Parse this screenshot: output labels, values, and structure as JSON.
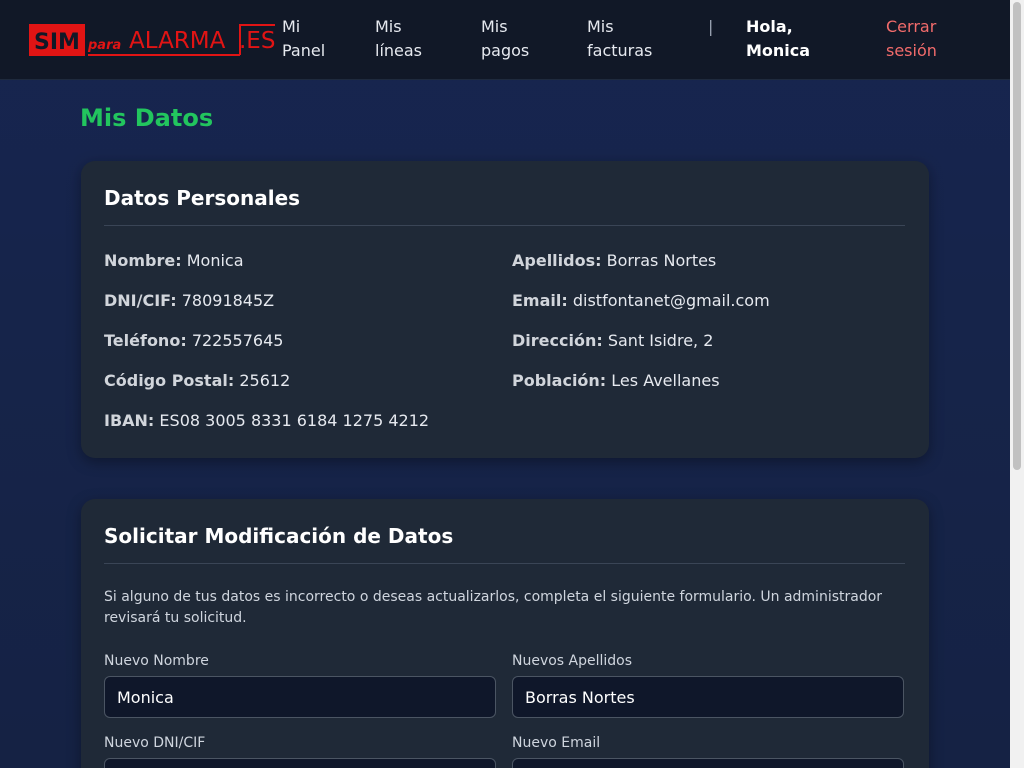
{
  "header": {
    "logo": {
      "sim": "SIM",
      "para": "para",
      "alarma": "ALARMA",
      "es": ".ES"
    },
    "nav": [
      {
        "line1": "Mi",
        "line2": "Panel"
      },
      {
        "line1": "Mis",
        "line2": "líneas"
      },
      {
        "line1": "Mis",
        "line2": "pagos"
      },
      {
        "line1": "Mis",
        "line2": "facturas"
      }
    ],
    "separator": "|",
    "greeting_line1": "Hola,",
    "greeting_line2": "Monica",
    "logout_line1": "Cerrar",
    "logout_line2": "sesión"
  },
  "page": {
    "title": "Mis Datos"
  },
  "personal": {
    "title": "Datos Personales",
    "nombre_label": "Nombre:",
    "nombre": "Monica",
    "apellidos_label": "Apellidos:",
    "apellidos": "Borras Nortes",
    "dni_label": "DNI/CIF:",
    "dni": "78091845Z",
    "email_label": "Email:",
    "email": "distfontanet@gmail.com",
    "telefono_label": "Teléfono:",
    "telefono": "722557645",
    "direccion_label": "Dirección:",
    "direccion": "Sant Isidre, 2",
    "cp_label": "Código Postal:",
    "cp": "25612",
    "poblacion_label": "Población:",
    "poblacion": "Les Avellanes",
    "iban_label": "IBAN:",
    "iban": "ES08 3005 8331 6184 1275 4212"
  },
  "modify": {
    "title": "Solicitar Modificación de Datos",
    "intro": "Si alguno de tus datos es incorrecto o deseas actualizarlos, completa el siguiente formulario. Un administrador revisará tu solicitud.",
    "nombre_label": "Nuevo Nombre",
    "nombre_value": "Monica",
    "apellidos_label": "Nuevos Apellidos",
    "apellidos_value": "Borras Nortes",
    "dni_label": "Nuevo DNI/CIF",
    "email_label": "Nuevo Email"
  },
  "colors": {
    "accent_green": "#22c55e",
    "logo_red": "#e11414",
    "logout_red": "#f26b6b",
    "card_bg": "#1f2937",
    "header_bg": "#111827"
  }
}
